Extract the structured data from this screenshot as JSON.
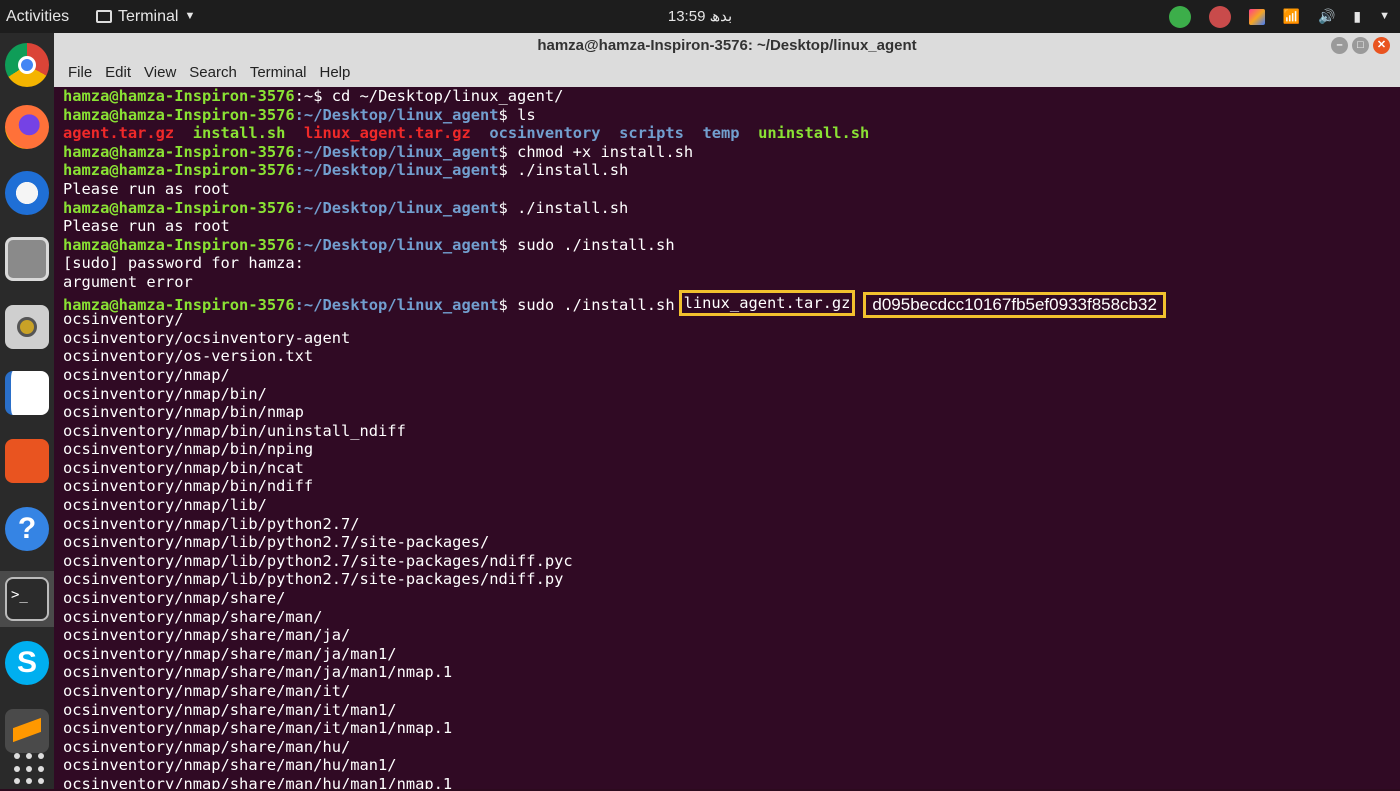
{
  "topbar": {
    "activities": "Activities",
    "app_menu": "Terminal",
    "clock": "13:59 بدھ"
  },
  "window": {
    "title": "hamza@hamza-Inspiron-3576: ~/Desktop/linux_agent",
    "menu": [
      "File",
      "Edit",
      "View",
      "Search",
      "Terminal",
      "Help"
    ]
  },
  "terminal": {
    "user": "hamza@hamza-Inspiron-3576",
    "home_prompt_path": ":~$",
    "agent_path": ":~/Desktop/linux_agent",
    "cmd_cd": " cd ~/Desktop/linux_agent/",
    "cmd_ls": " ls",
    "ls_agent_tar": "agent.tar.gz",
    "ls_install": "install.sh",
    "ls_linux_tar": "linux_agent.tar.gz",
    "ls_ocs": "ocsinventory",
    "ls_scripts": "scripts",
    "ls_temp": "temp",
    "ls_uninstall": "uninstall.sh",
    "cmd_chmod": " chmod +x install.sh",
    "cmd_run": " ./install.sh",
    "please_root": "Please run as root",
    "cmd_sudo": " sudo ./install.sh",
    "sudo_pw": "[sudo] password for hamza:",
    "arg_error": "argument error",
    "highlight_file": "linux_agent.tar.gz",
    "highlight_hash": "d095becdcc10167fb5ef0933f858cb32",
    "output": [
      "ocsinventory/",
      "ocsinventory/ocsinventory-agent",
      "ocsinventory/os-version.txt",
      "ocsinventory/nmap/",
      "ocsinventory/nmap/bin/",
      "ocsinventory/nmap/bin/nmap",
      "ocsinventory/nmap/bin/uninstall_ndiff",
      "ocsinventory/nmap/bin/nping",
      "ocsinventory/nmap/bin/ncat",
      "ocsinventory/nmap/bin/ndiff",
      "ocsinventory/nmap/lib/",
      "ocsinventory/nmap/lib/python2.7/",
      "ocsinventory/nmap/lib/python2.7/site-packages/",
      "ocsinventory/nmap/lib/python2.7/site-packages/ndiff.pyc",
      "ocsinventory/nmap/lib/python2.7/site-packages/ndiff.py",
      "ocsinventory/nmap/share/",
      "ocsinventory/nmap/share/man/",
      "ocsinventory/nmap/share/man/ja/",
      "ocsinventory/nmap/share/man/ja/man1/",
      "ocsinventory/nmap/share/man/ja/man1/nmap.1",
      "ocsinventory/nmap/share/man/it/",
      "ocsinventory/nmap/share/man/it/man1/",
      "ocsinventory/nmap/share/man/it/man1/nmap.1",
      "ocsinventory/nmap/share/man/hu/",
      "ocsinventory/nmap/share/man/hu/man1/",
      "ocsinventory/nmap/share/man/hu/man1/nmap.1"
    ]
  }
}
